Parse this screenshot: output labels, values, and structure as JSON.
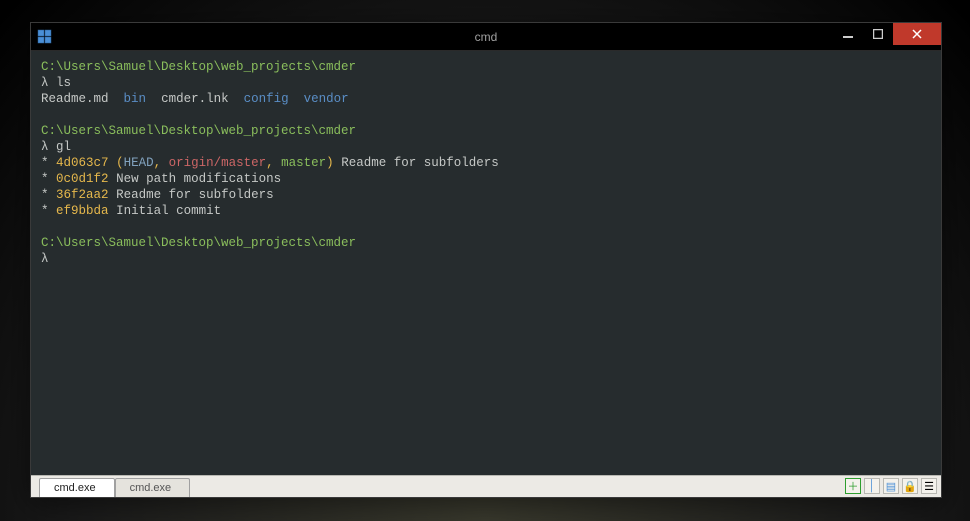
{
  "titlebar": {
    "title": "cmd"
  },
  "terminal": {
    "prompt_path": "C:\\Users\\Samuel\\Desktop\\web_projects\\cmder",
    "prompt_symbol": "λ",
    "cmd1": "ls",
    "ls_output": {
      "f0": "Readme.md",
      "f1": "bin",
      "f2": "cmder.lnk",
      "f3": "config",
      "f4": "vendor"
    },
    "cmd2": "gl",
    "log": [
      {
        "hash": "4d063c7",
        "head_label": "HEAD",
        "remote_label": "origin/master",
        "branch_label": "master",
        "lp": "(",
        "cm1": ", ",
        "cm2": ", ",
        "rp": ")",
        "msg": "Readme for subfolders"
      },
      {
        "hash": "0c0d1f2",
        "msg": "New path modifications"
      },
      {
        "hash": "36f2aa2",
        "msg": "Readme for subfolders"
      },
      {
        "hash": "ef9bbda",
        "msg": "Initial commit"
      }
    ],
    "bullet": "*"
  },
  "tabs": {
    "t0": "cmd.exe",
    "t1": "cmd.exe"
  },
  "icons": {
    "plus": "＋",
    "sep": "│",
    "panes": "▤",
    "lock": "🔒",
    "menu": "☰"
  }
}
